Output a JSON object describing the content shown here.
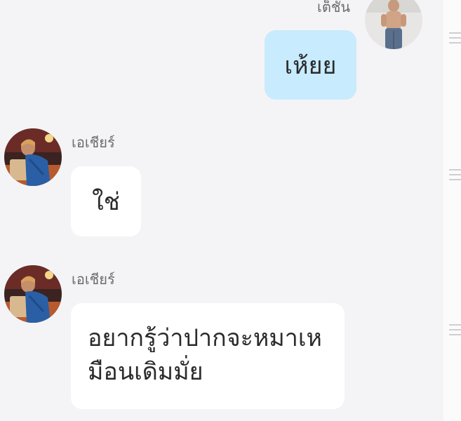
{
  "messages": [
    {
      "sender": "เต็ชัน",
      "text": "เห้ยย",
      "direction": "outgoing"
    },
    {
      "sender": "เอเชียร์",
      "text": "ใช่",
      "direction": "incoming"
    },
    {
      "sender": "เอเชียร์",
      "text": "อยากรู้ว่าปากจะหมาเหมือนเดิมมั่ย",
      "text_lines": [
        "อยากรู้ว่าปากจะหมาเห",
        "มือนเดิมมั่ย"
      ],
      "direction": "incoming"
    }
  ],
  "icons": {
    "menu": "hamburger-menu-icon",
    "avatar_outgoing": "avatar-person-shirtless",
    "avatar_incoming": "avatar-person-blue-shirt"
  },
  "colors": {
    "background": "#f4f4f6",
    "outgoing_bubble": "#c8ebfd",
    "incoming_bubble": "#ffffff",
    "text": "#2b2b2b",
    "sender_name": "#6b6b6b"
  }
}
